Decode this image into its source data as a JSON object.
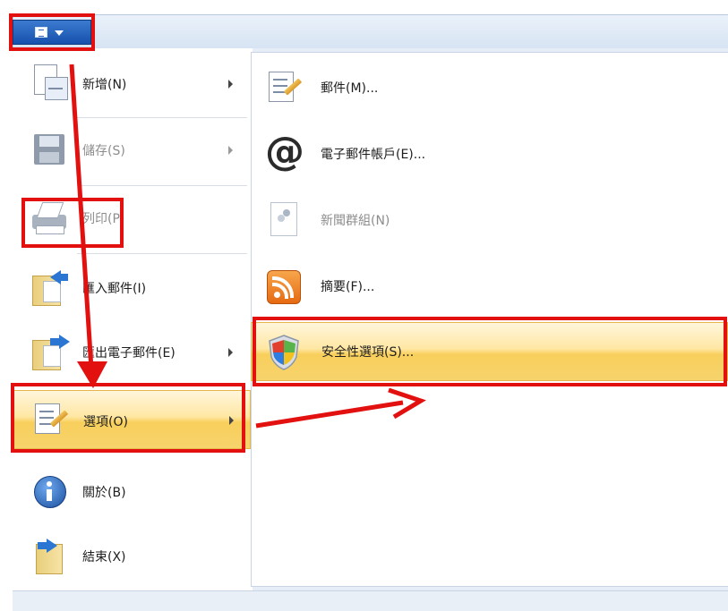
{
  "toolbar": {
    "app_menu_icon": "menu-grid-icon"
  },
  "left_menu": {
    "items": [
      {
        "label": "新增(N)",
        "icon": "new-document-icon",
        "submenu": true,
        "disabled": false
      },
      {
        "label": "儲存(S)",
        "icon": "floppy-disk-icon",
        "submenu": true,
        "disabled": true
      },
      {
        "label": "列印(P)",
        "icon": "printer-icon",
        "submenu": false,
        "disabled": true
      },
      {
        "label": "匯入郵件(I)",
        "icon": "import-folder-icon",
        "submenu": false,
        "disabled": false
      },
      {
        "label": "匯出電子郵件(E)",
        "icon": "export-folder-icon",
        "submenu": true,
        "disabled": false
      },
      {
        "label": "選項(O)",
        "icon": "options-list-icon",
        "submenu": true,
        "disabled": false,
        "highlighted": true
      },
      {
        "label": "關於(B)",
        "icon": "info-icon",
        "submenu": false,
        "disabled": false
      },
      {
        "label": "結束(X)",
        "icon": "exit-folder-icon",
        "submenu": false,
        "disabled": false
      }
    ]
  },
  "right_menu": {
    "items": [
      {
        "label": "郵件(M)...",
        "icon": "mail-options-icon",
        "disabled": false
      },
      {
        "label": "電子郵件帳戶(E)...",
        "icon": "at-sign-icon",
        "disabled": false
      },
      {
        "label": "新聞群組(N)",
        "icon": "newsgroup-icon",
        "disabled": true
      },
      {
        "label": "摘要(F)...",
        "icon": "rss-feed-icon",
        "disabled": false
      },
      {
        "label": "安全性選項(S)...",
        "icon": "security-shield-icon",
        "disabled": false,
        "highlighted": true
      }
    ]
  },
  "colors": {
    "annotation_red": "#e31010",
    "highlight_gold": "#f8cf5c",
    "app_button_blue": "#1651ad"
  }
}
